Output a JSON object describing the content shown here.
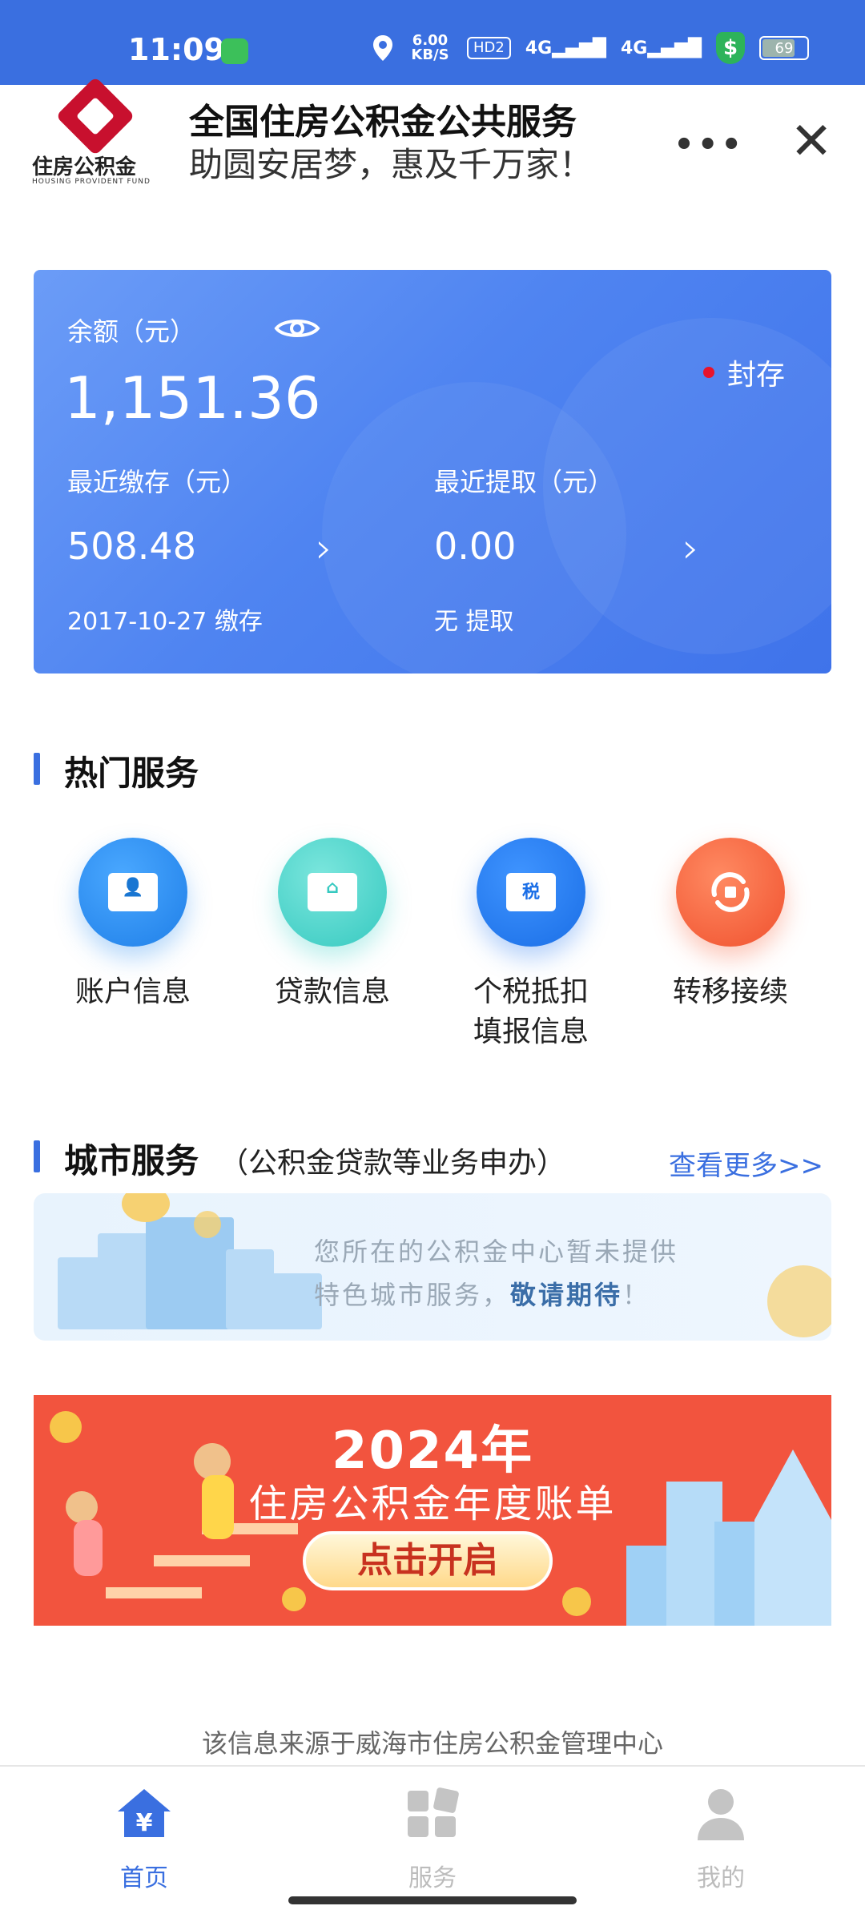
{
  "status_bar": {
    "time": "11:09",
    "net_speed": "6.00 KB/S",
    "hd_label": "HD2",
    "signal1": "4G",
    "signal2": "4G",
    "shield_symbol": "$",
    "battery": "69"
  },
  "header": {
    "logo_cn": "住房公积金",
    "logo_en": "HOUSING PROVIDENT FUND",
    "title": "全国住房公积金公共服务",
    "subtitle": "助圆安居梦，惠及千万家！",
    "more_label": "•••",
    "close_label": "✕"
  },
  "account_card": {
    "balance_label": "余额（元）",
    "balance": "1,151.36",
    "status": "封存",
    "recent_deposit_label": "最近缴存（元）",
    "recent_deposit_value": "508.48",
    "recent_deposit_note": "2017-10-27 缴存",
    "recent_withdraw_label": "最近提取（元）",
    "recent_withdraw_value": "0.00",
    "recent_withdraw_note": "无 提取",
    "chevron": "›"
  },
  "hot_services": {
    "title": "热门服务",
    "items": [
      {
        "label": "账户信息",
        "icon": "account-card-icon",
        "color": "#2f8ff0"
      },
      {
        "label": "贷款信息",
        "icon": "loan-card-icon",
        "color": "#3fd0c8"
      },
      {
        "label": "个税抵扣填报信息",
        "icon": "tax-card-icon",
        "color": "#2a7cf0",
        "icon_text": "税"
      },
      {
        "label": "转移接续",
        "icon": "transfer-icon",
        "color": "#f5613c"
      }
    ]
  },
  "city_services": {
    "title": "城市服务",
    "subtitle": "（公积金贷款等业务申办）",
    "more_link": "查看更多>>",
    "banner_line1": "您所在的公积金中心暂未提供",
    "banner_line2_prefix": "特色城市服务，",
    "banner_line2_highlight": "敬请期待",
    "banner_line2_suffix": "！"
  },
  "promo": {
    "year": "2024年",
    "subtitle": "住房公积金年度账单",
    "button": "点击开启"
  },
  "footer": {
    "source": "该信息来源于威海市住房公积金管理中心"
  },
  "tabbar": {
    "tabs": [
      {
        "label": "首页",
        "icon": "home-icon",
        "active": true
      },
      {
        "label": "服务",
        "icon": "services-icon",
        "active": false
      },
      {
        "label": "我的",
        "icon": "profile-icon",
        "active": false
      }
    ],
    "active_color": "#3a6fe0",
    "inactive_color": "#bcbcbc"
  }
}
